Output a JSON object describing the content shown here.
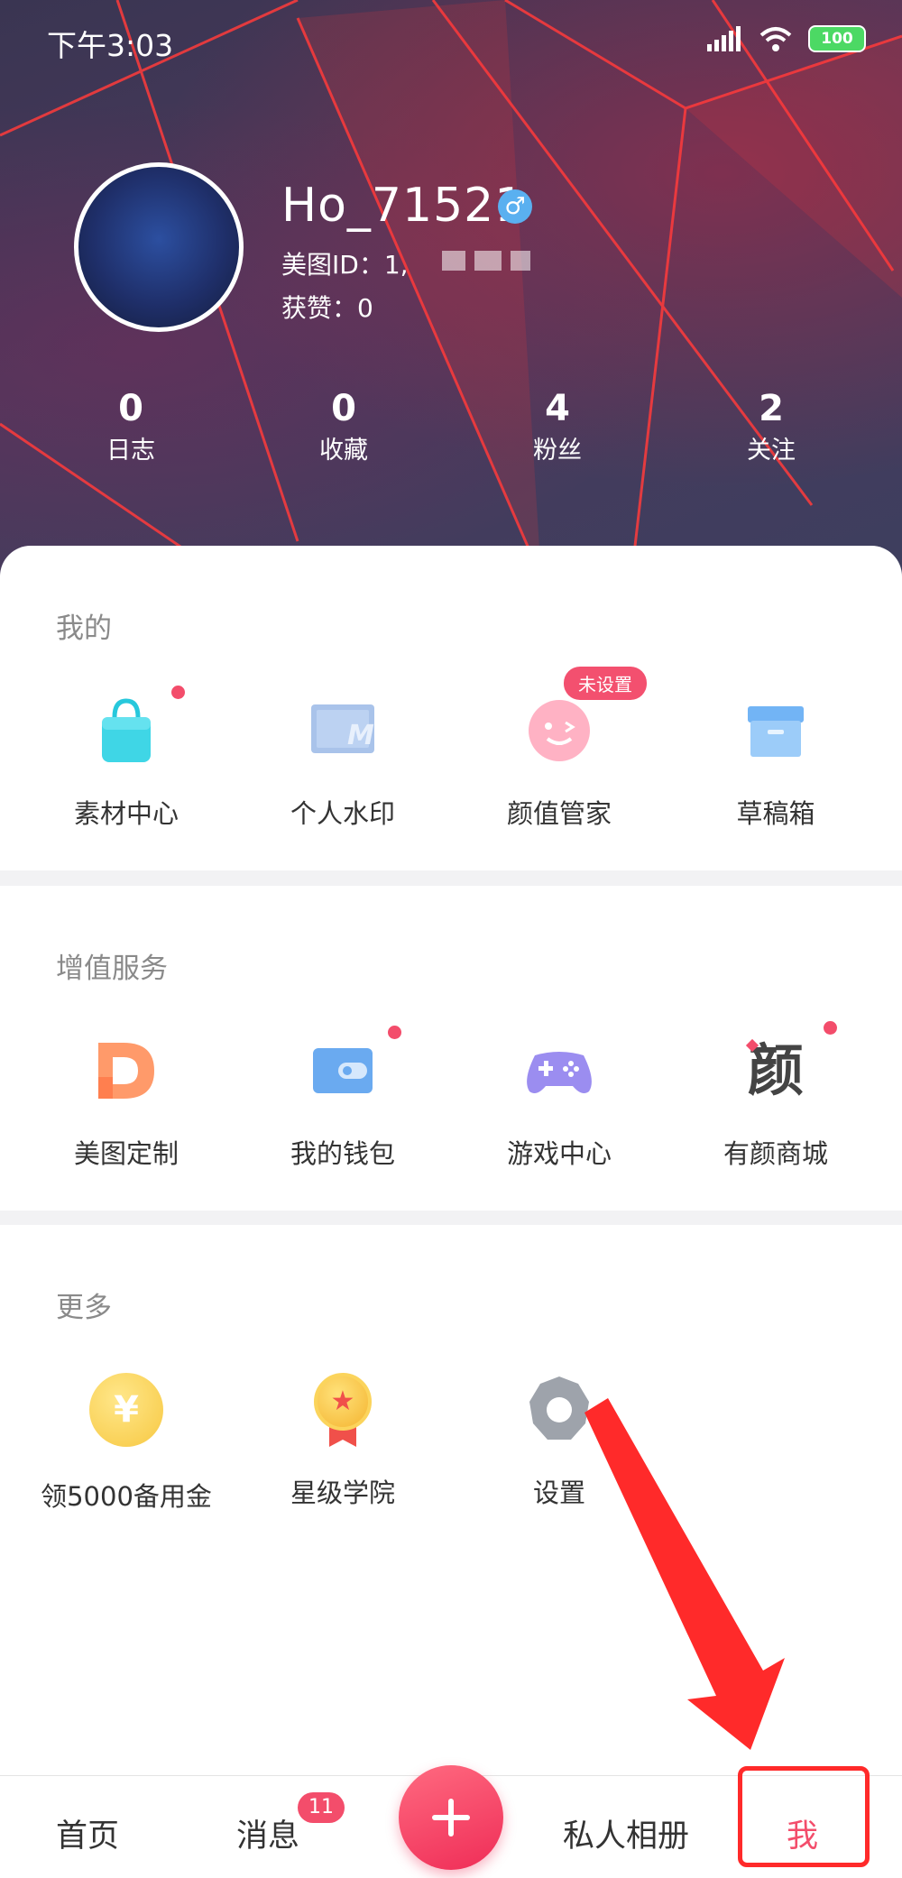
{
  "status_bar": {
    "time": "下午3:03",
    "battery": "100"
  },
  "profile": {
    "username": "Ho_71521",
    "gender_symbol": "♂",
    "meitu_id_label": "美图ID：1,",
    "likes_label": "获赞：0"
  },
  "stats": [
    {
      "value": "0",
      "label": "日志"
    },
    {
      "value": "0",
      "label": "收藏"
    },
    {
      "value": "4",
      "label": "粉丝"
    },
    {
      "value": "2",
      "label": "关注"
    }
  ],
  "sections": {
    "mine": {
      "title": "我的",
      "items": [
        {
          "label": "素材中心",
          "icon": "shopping-bag-icon"
        },
        {
          "label": "个人水印",
          "icon": "watermark-icon"
        },
        {
          "label": "颜值管家",
          "icon": "face-icon",
          "badge": "未设置"
        },
        {
          "label": "草稿箱",
          "icon": "draft-box-icon"
        }
      ]
    },
    "value_added": {
      "title": "增值服务",
      "items": [
        {
          "label": "美图定制",
          "icon": "custom-d-icon"
        },
        {
          "label": "我的钱包",
          "icon": "wallet-icon"
        },
        {
          "label": "游戏中心",
          "icon": "gamepad-icon"
        },
        {
          "label": "有颜商城",
          "icon": "yan-mall-icon",
          "glyph": "颜"
        }
      ]
    },
    "more": {
      "title": "更多",
      "items": [
        {
          "label": "领5000备用金",
          "icon": "yen-coin-icon",
          "glyph": "¥"
        },
        {
          "label": "星级学院",
          "icon": "star-medal-icon",
          "glyph": "★"
        },
        {
          "label": "设置",
          "icon": "gear-icon"
        }
      ]
    }
  },
  "tabbar": {
    "home": "首页",
    "messages": "消息",
    "messages_badge": "11",
    "album": "私人相册",
    "me": "我"
  },
  "colors": {
    "accent": "#f34d6b",
    "annotation": "#ff2a2a"
  }
}
